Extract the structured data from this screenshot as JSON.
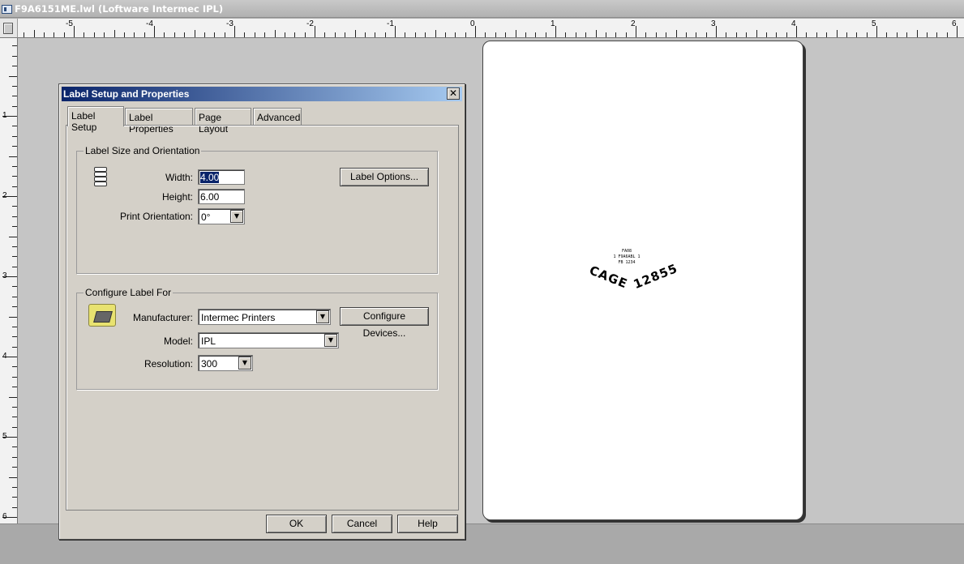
{
  "window": {
    "title": "F9A6151ME.lwl (Loftware Intermec IPL)"
  },
  "ruler": {
    "h_labels": [
      "-5",
      "-4",
      "-3",
      "-2",
      "-1",
      "0",
      "1",
      "2",
      "3",
      "4",
      "5",
      "6"
    ],
    "v_labels": [
      "1",
      "2",
      "3",
      "4",
      "5",
      "6"
    ]
  },
  "label_preview": {
    "small_text": [
      "FA08",
      "1 F9A6ABL 1",
      "FB 1234"
    ],
    "cage_text": "CAGE",
    "code_text": "12855"
  },
  "dialog": {
    "title": "Label Setup and Properties",
    "close_symbol": "✕",
    "tabs": [
      "Label Setup",
      "Label Properties",
      "Page Layout",
      "Advanced"
    ],
    "active_tab": "Label Setup",
    "size_group": {
      "title": "Label Size and Orientation",
      "width_label": "Width:",
      "width_value": "4.00",
      "height_label": "Height:",
      "height_value": "6.00",
      "orientation_label": "Print Orientation:",
      "orientation_value": "0°",
      "label_options_button": "Label Options..."
    },
    "configure_group": {
      "title": "Configure Label For",
      "manufacturer_label": "Manufacturer:",
      "manufacturer_value": "Intermec Printers",
      "configure_devices_button": "Configure Devices...",
      "model_label": "Model:",
      "model_value": "IPL",
      "resolution_label": "Resolution:",
      "resolution_value": "300"
    },
    "buttons": {
      "ok": "OK",
      "cancel": "Cancel",
      "help": "Help"
    }
  },
  "icons": {
    "combo_arrow": "▼",
    "app_icon": "document-window-icon",
    "paper_icon": "label-roll-icon",
    "printer_icon": "printer-folder-icon"
  }
}
